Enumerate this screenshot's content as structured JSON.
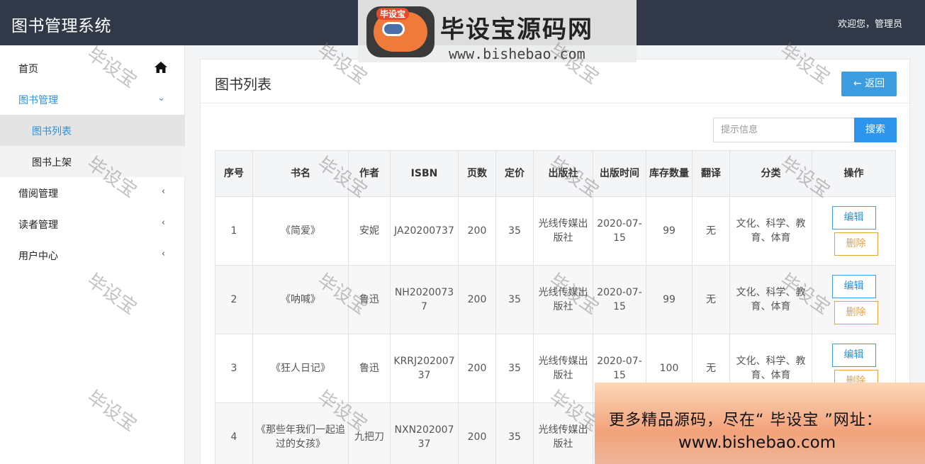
{
  "app": {
    "title": "图书管理系统",
    "welcome": "欢迎您，管理员"
  },
  "logo": {
    "badge": "毕设宝",
    "name": "毕设宝源码网",
    "url": "www.bishebao.com"
  },
  "sidebar": {
    "items": [
      {
        "label": "首页",
        "icon": "home-icon"
      },
      {
        "label": "图书管理",
        "icon": "chevron-down-icon"
      },
      {
        "label": "图书列表"
      },
      {
        "label": "图书上架"
      },
      {
        "label": "借阅管理",
        "icon": "chevron-left-icon"
      },
      {
        "label": "读者管理",
        "icon": "chevron-left-icon"
      },
      {
        "label": "用户中心",
        "icon": "chevron-left-icon"
      }
    ],
    "active_color": "#2d8fdc"
  },
  "main": {
    "title": "图书列表",
    "back_label": "返回",
    "search_placeholder": "提示信息",
    "search_label": "搜索"
  },
  "table": {
    "headers": [
      "序号",
      "书名",
      "作者",
      "ISBN",
      "页数",
      "定价",
      "出版社",
      "出版时间",
      "库存数量",
      "翻译",
      "分类",
      "操作"
    ],
    "rows": [
      [
        "1",
        "《简爱》",
        "安妮",
        "JA20200737",
        "200",
        "35",
        "光线传媒出版社",
        "2020-07-15",
        "99",
        "无",
        "文化、科学、教育、体育"
      ],
      [
        "2",
        "《呐喊》",
        "鲁迅",
        "NH20200737",
        "200",
        "35",
        "光线传媒出版社",
        "2020-07-15",
        "99",
        "无",
        "文化、科学、教育、体育"
      ],
      [
        "3",
        "《狂人日记》",
        "鲁迅",
        "KRRJ20200737",
        "200",
        "35",
        "光线传媒出版社",
        "2020-07-15",
        "100",
        "无",
        "文化、科学、教育、体育"
      ],
      [
        "4",
        "《那些年我们一起追过的女孩》",
        "九把刀",
        "NXN20200737",
        "200",
        "35",
        "光线传媒出版社",
        "",
        "",
        "",
        ""
      ]
    ],
    "edit_label": "编辑",
    "delete_label": "删除"
  },
  "watermark": "毕设宝",
  "promo": {
    "line1": "更多精品源码，尽在“ 毕设宝 ”网址：",
    "line2": "www.bishebao.com"
  },
  "colors": {
    "topbar": "#313848",
    "primary": "#3c9ce0",
    "warning": "#e7a13d"
  }
}
